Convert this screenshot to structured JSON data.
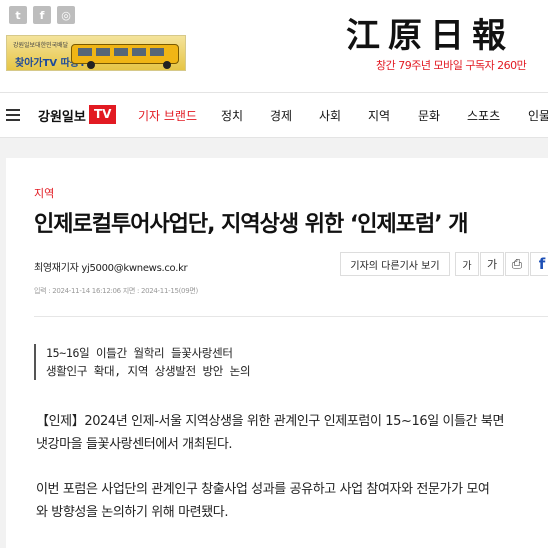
{
  "header": {
    "social": [
      {
        "label": "t",
        "icon": "twitter-icon"
      },
      {
        "label": "f",
        "icon": "facebook-icon"
      },
      {
        "label": "◎",
        "icon": "instagram-icon"
      }
    ],
    "banner": {
      "small_text": "강원일보대한민국배달",
      "tv_text": "찾아가TV 따봉TV"
    },
    "logo_text": "江原日報",
    "anniversary": "창간 79주년 모바일 구독자 260만"
  },
  "nav": {
    "brand": "강원일보",
    "tv_badge": "TV",
    "items": [
      "기자 브랜드",
      "정치",
      "경제",
      "사회",
      "지역",
      "문화",
      "스포츠",
      "인물"
    ]
  },
  "article": {
    "section": "지역",
    "headline": "인제로컬투어사업단, 지역상생 위한 ‘인제포럼’ 개",
    "byline": "최영재기자 yj5000@kwnews.co.kr",
    "more_button": "기자의 다른기사 보기",
    "font_small": "가",
    "font_large": "가",
    "print_icon": "⎙",
    "facebook": "f",
    "dates": "입력 : 2024-11-14 16:12:06 지면 : 2024-11-15(09면)",
    "summary": [
      "15~16일 이틀간 월학리 들꽃사랑센터",
      "생활인구 확대, 지역 상생발전 방안 논의"
    ],
    "paragraphs": [
      [
        "【인제】2024년 인제-서울 지역상생을 위한 관계인구 인제포럼이 15~16일 이틀간 북면",
        "냇강마을 들꽃사랑센터에서 개최된다."
      ],
      [
        "이번 포럼은 사업단의 관계인구 창출사업 성과를 공유하고 사업 참여자와 전문가가 모여 ",
        "와 방향성을 논의하기 위해 마련됐다."
      ]
    ]
  },
  "colors": {
    "accent": "#e21a22",
    "facebook": "#1d4fb5"
  }
}
